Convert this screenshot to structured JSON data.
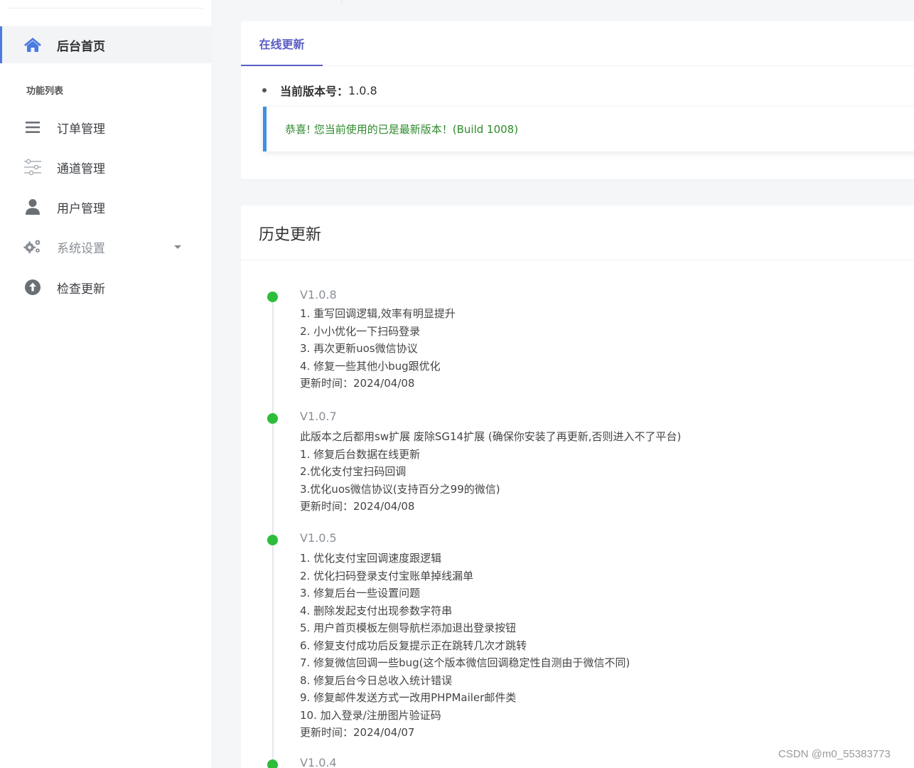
{
  "sidebar": {
    "section_title": "功能列表",
    "items": [
      {
        "label": "后台首页",
        "icon": "home-icon",
        "active": true
      },
      {
        "label": "订单管理",
        "icon": "list-icon"
      },
      {
        "label": "通道管理",
        "icon": "sliders-icon"
      },
      {
        "label": "用户管理",
        "icon": "user-icon"
      },
      {
        "label": "系统设置",
        "icon": "gears-icon",
        "has_dropdown": true
      },
      {
        "label": "检查更新",
        "icon": "arrow-up-circle-icon"
      }
    ]
  },
  "update_card": {
    "tab_label": "在线更新",
    "current_version_label": "当前版本号：",
    "current_version_value": "1.0.8",
    "alert_text": "恭喜! 您当前使用的已是最新版本！(Build 1008)"
  },
  "history": {
    "title": "历史更新",
    "entries": [
      {
        "version": "V1.0.8",
        "lines": [
          "1. 重写回调逻辑,效率有明显提升",
          "2. 小小优化一下扫码登录",
          "3. 再次更新uos微信协议",
          "4. 修复一些其他小bug跟优化",
          "更新时间：2024/04/08"
        ]
      },
      {
        "version": "V1.0.7",
        "lines": [
          "此版本之后都用sw扩展 废除SG14扩展 (确保你安装了再更新,否则进入不了平台)",
          "1. 修复后台数据在线更新",
          "2.优化支付宝扫码回调",
          "3.优化uos微信协议(支持百分之99的微信)",
          "更新时间：2024/04/08"
        ]
      },
      {
        "version": "V1.0.5",
        "lines": [
          "1. 优化支付宝回调速度跟逻辑",
          "2. 优化扫码登录支付宝账单掉线漏单",
          "3. 修复后台一些设置问题",
          "4. 删除发起支付出现参数字符串",
          "5. 用户首页模板左侧导航栏添加退出登录按钮",
          "6. 修复支付成功后反复提示正在跳转几次才跳转",
          "7. 修复微信回调一些bug(这个版本微信回调稳定性自测由于微信不同)",
          "8. 修复后台今日总收入统计错误",
          "9. 修复邮件发送方式一改用PHPMailer邮件类",
          "10. 加入登录/注册图片验证码",
          "更新时间：2024/04/07"
        ]
      },
      {
        "version": "V1.0.4",
        "lines": []
      }
    ]
  },
  "watermark": "CSDN @m0_55383773",
  "colors": {
    "accent": "#5a5ec4",
    "sidebar_active_bar": "#4a7be0",
    "timeline_dot": "#2dbd3a",
    "alert_border": "#3f8fe0",
    "alert_text": "#2e8a2e"
  }
}
